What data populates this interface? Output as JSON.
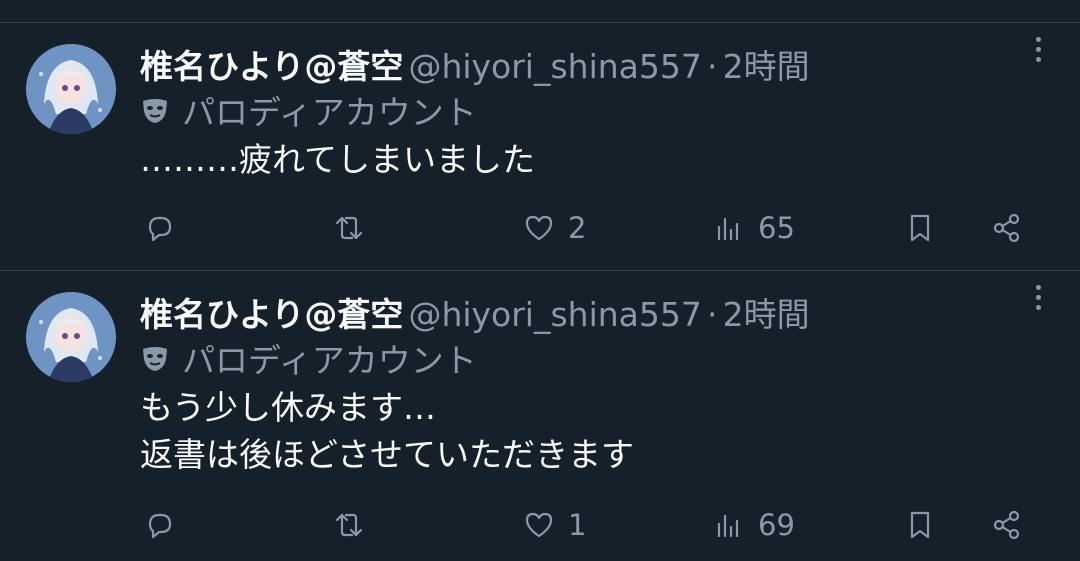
{
  "tweets": [
    {
      "display_name": "椎名ひより@蒼空",
      "handle": "@hiyori_shina557",
      "separator": "·",
      "time": "2時間",
      "account_label": "パロディアカウント",
      "text_lines": [
        "………疲れてしまいました"
      ],
      "likes": "2",
      "views": "65"
    },
    {
      "display_name": "椎名ひより@蒼空",
      "handle": "@hiyori_shina557",
      "separator": "·",
      "time": "2時間",
      "account_label": "パロディアカウント",
      "text_lines": [
        "もう少し休みます…",
        "返書は後ほどさせていただきます"
      ],
      "likes": "1",
      "views": "69"
    }
  ],
  "colors": {
    "background": "#15202b",
    "primary_text": "#f7f9f9",
    "secondary_text": "#8b98a5",
    "divider": "#38444d"
  },
  "icons": [
    "reply-icon",
    "retweet-icon",
    "like-icon",
    "views-icon",
    "bookmark-icon",
    "share-icon",
    "more-icon",
    "parody-mask-icon"
  ]
}
